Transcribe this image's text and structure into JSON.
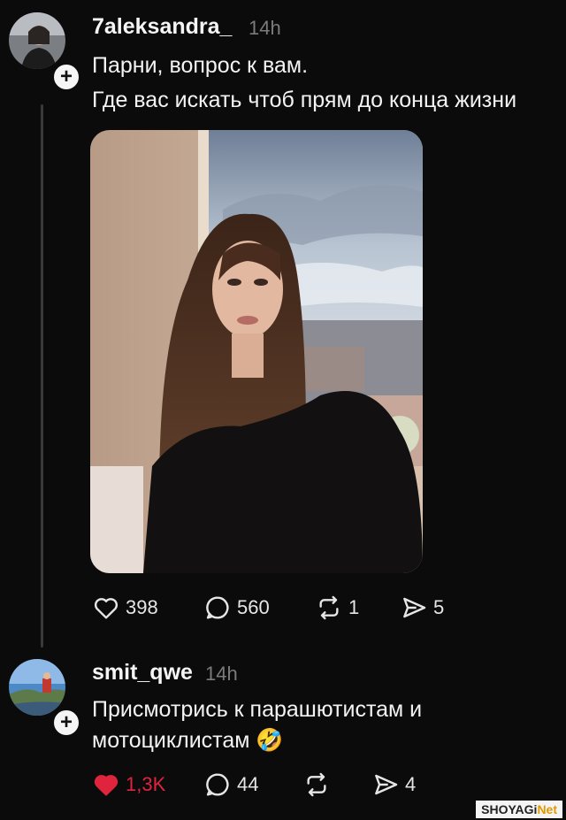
{
  "post": {
    "username": "7aleksandra_",
    "time": "14h",
    "text_line1": "Парни, вопрос к вам.",
    "text_line2": "Где вас искать чтоб прям до конца жизни",
    "likes": "398",
    "comments": "560",
    "reposts": "1",
    "shares": "5"
  },
  "reply": {
    "username": "smit_qwe",
    "time": "14h",
    "text_line1": "Присмотрись к парашютистам и",
    "text_line2": "мотоциклистам",
    "emoji": "🤣",
    "likes": "1,3K",
    "comments": "44",
    "shares": "4"
  },
  "watermark": {
    "left": "SHOYAGi",
    "right": "Net"
  },
  "colors": {
    "background": "#0b0b0b",
    "liked_heart": "#e0243d",
    "muted": "#7b7b7b"
  }
}
